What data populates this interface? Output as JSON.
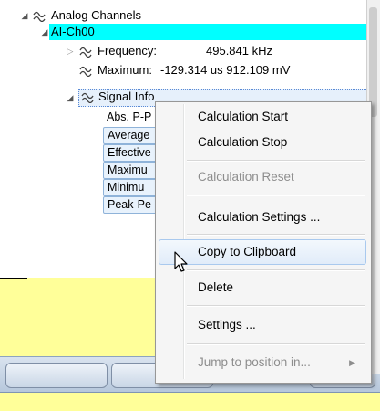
{
  "tree": {
    "root": {
      "label": "Analog Channels",
      "expand_glyph": "◢",
      "icon": "waveform-icon"
    },
    "channel": {
      "label": "AI-Ch00",
      "expand_glyph": "◢"
    },
    "rows": [
      {
        "name": "Frequency:",
        "value": "495.841 kHz",
        "expand_glyph": "▷",
        "icon": "waveform-icon"
      },
      {
        "name": "Maximum:",
        "value": "-129.314 us 912.109 mV",
        "icon": "waveform-icon"
      }
    ],
    "signal_info": {
      "label": "Signal Info",
      "expand_glyph": "◢",
      "icon": "waveform-icon"
    },
    "abs_row": {
      "label": "Abs. P-P"
    },
    "chips": [
      {
        "label": "Average"
      },
      {
        "label": "Effective"
      },
      {
        "label": "Maximu"
      },
      {
        "label": "Minimu"
      },
      {
        "label": "Peak-Pe"
      }
    ]
  },
  "context_menu": {
    "items": [
      {
        "label": "Calculation Start",
        "enabled": true
      },
      {
        "label": "Calculation Stop",
        "enabled": true
      },
      {
        "label": "Calculation Reset",
        "enabled": false
      },
      {
        "label": "Calculation Settings ...",
        "enabled": true
      },
      {
        "label": "Copy to Clipboard",
        "enabled": true,
        "hovered": true
      },
      {
        "label": "Delete",
        "enabled": true
      },
      {
        "label": "Settings ...",
        "enabled": true
      },
      {
        "label": "Jump to position in...",
        "enabled": false,
        "submenu_glyph": "▶"
      }
    ]
  },
  "colors": {
    "selection": "#00ffff",
    "yellow_panel": "#ffff99",
    "menu_background": "#f5f5f5",
    "hover": "#e1ecf9"
  },
  "icons": [
    "waveform-icon",
    "expand-arrow-icon",
    "collapse-arrow-icon",
    "submenu-arrow-icon",
    "mouse-cursor-icon"
  ]
}
